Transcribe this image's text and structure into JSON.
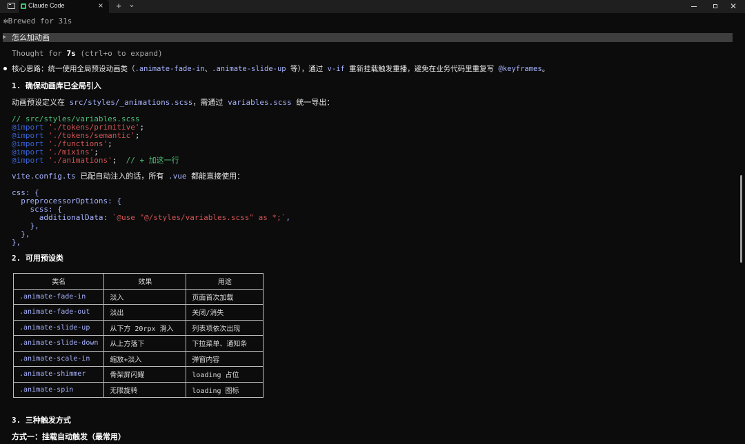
{
  "titlebar": {
    "tab_title": "Claude Code",
    "tab_close": "×",
    "new_tab": "+",
    "tab_dropdown": "⌄",
    "win_close": "✕"
  },
  "terminal": {
    "status_glyph": "✻",
    "status": "Brewed for 31s",
    "prompt_caret": "▶",
    "prompt": "怎么加动画",
    "thought_prefix": "Thought for ",
    "thought_time": "7s",
    "thought_suffix": " (ctrl+o to expand)",
    "intro": {
      "a": "核心思路：统一使用全局预设动画类（",
      "c1": ".animate-fade-in",
      "b": "、",
      "c2": ".animate-slide-up",
      "c": " 等），通过 ",
      "c3": "v-if",
      "d": " 重新挂载触发重播，避免在业务代码里重复写 ",
      "c4": "@keyframes",
      "e": "。"
    },
    "h1": "1. 确保动画库已全局引入",
    "p1": {
      "a": "动画预设定义在 ",
      "c1": "src/styles/_animations.scss",
      "b": "，需通过 ",
      "c2": "variables.scss",
      "c": " 统一导出："
    },
    "scss": {
      "comment": "// src/styles/variables.scss",
      "kw": "@import",
      "imports": [
        "'./tokens/primitive'",
        "'./tokens/semantic'",
        "'./functions'",
        "'./mixins'",
        "'./animations'"
      ],
      "semi": ";",
      "add_comment": "  // + 加这一行"
    },
    "p2": {
      "c1": "vite.config.ts",
      "a": " 已配自动注入的话，所有 ",
      "c2": ".vue",
      "b": " 都能直接使用："
    },
    "vite": {
      "l1": "css: {",
      "l2": "  preprocessorOptions: {",
      "l3": "    scss: {",
      "l4a": "      additionalData: ",
      "l4b": "`@use \"@/styles/variables.scss\" as *;`",
      "l4c": ",",
      "l5": "    },",
      "l6": "  },",
      "l7": "},"
    },
    "h2": "2. 可用预设类",
    "table": {
      "headers": [
        "类名",
        "效果",
        "用途"
      ],
      "rows": [
        [
          ".animate-fade-in",
          "淡入",
          "页面首次加载"
        ],
        [
          ".animate-fade-out",
          "淡出",
          "关闭/消失"
        ],
        [
          ".animate-slide-up",
          "从下方 20rpx 滑入",
          "列表项依次出现"
        ],
        [
          ".animate-slide-down",
          "从上方落下",
          "下拉菜单、通知条"
        ],
        [
          ".animate-scale-in",
          "缩放+淡入",
          "弹窗内容"
        ],
        [
          ".animate-shimmer",
          "骨架屏闪耀",
          "loading 占位"
        ],
        [
          ".animate-spin",
          "无限旋转",
          "loading 图标"
        ]
      ]
    },
    "h3": "3. 三种触发方式",
    "h3_sub": "方式一：挂载自动触发（最常用）"
  }
}
